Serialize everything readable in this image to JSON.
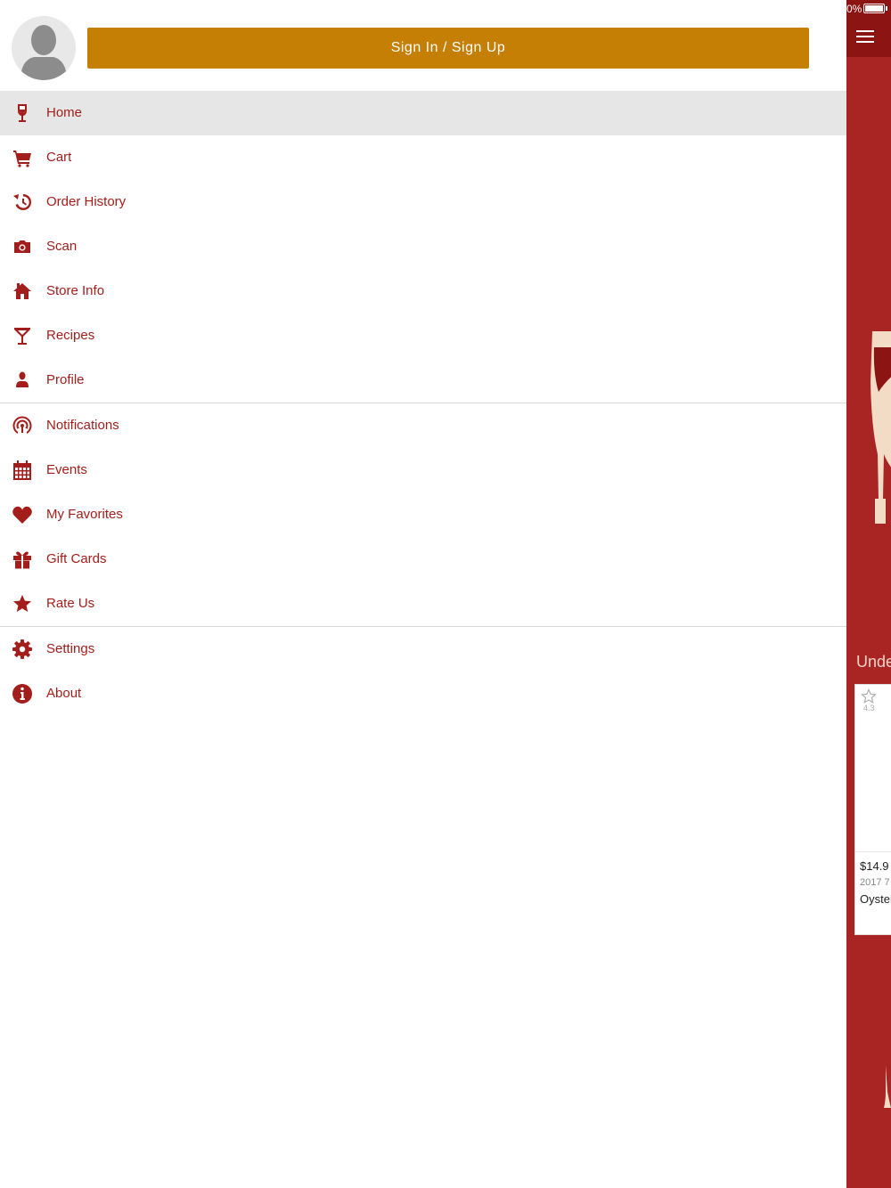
{
  "drawer": {
    "signin_label": "Sign In / Sign Up",
    "groups": [
      [
        {
          "label": "Home",
          "icon": "wine-glass-icon",
          "active": true
        },
        {
          "label": "Cart",
          "icon": "cart-icon"
        },
        {
          "label": "Order History",
          "icon": "history-icon"
        },
        {
          "label": "Scan",
          "icon": "camera-icon"
        },
        {
          "label": "Store Info",
          "icon": "store-icon"
        },
        {
          "label": "Recipes",
          "icon": "cocktail-icon"
        },
        {
          "label": "Profile",
          "icon": "person-icon"
        }
      ],
      [
        {
          "label": "Notifications",
          "icon": "broadcast-icon"
        },
        {
          "label": "Events",
          "icon": "calendar-icon"
        },
        {
          "label": "My Favorites",
          "icon": "heart-icon"
        },
        {
          "label": "Gift Cards",
          "icon": "gift-icon"
        },
        {
          "label": "Rate Us",
          "icon": "star-icon"
        }
      ],
      [
        {
          "label": "Settings",
          "icon": "gear-icon"
        },
        {
          "label": "About",
          "icon": "info-icon"
        }
      ]
    ]
  },
  "background": {
    "battery_text": "0%",
    "section_title": "Unde",
    "card": {
      "rating": "4.3",
      "price": "$14.9",
      "vintage": "2017 7",
      "name": "Oyster"
    }
  },
  "colors": {
    "accent": "#a31e1a",
    "button": "#c47f04",
    "active_bg": "#e6e6e6",
    "page_bg": "#a92523"
  }
}
